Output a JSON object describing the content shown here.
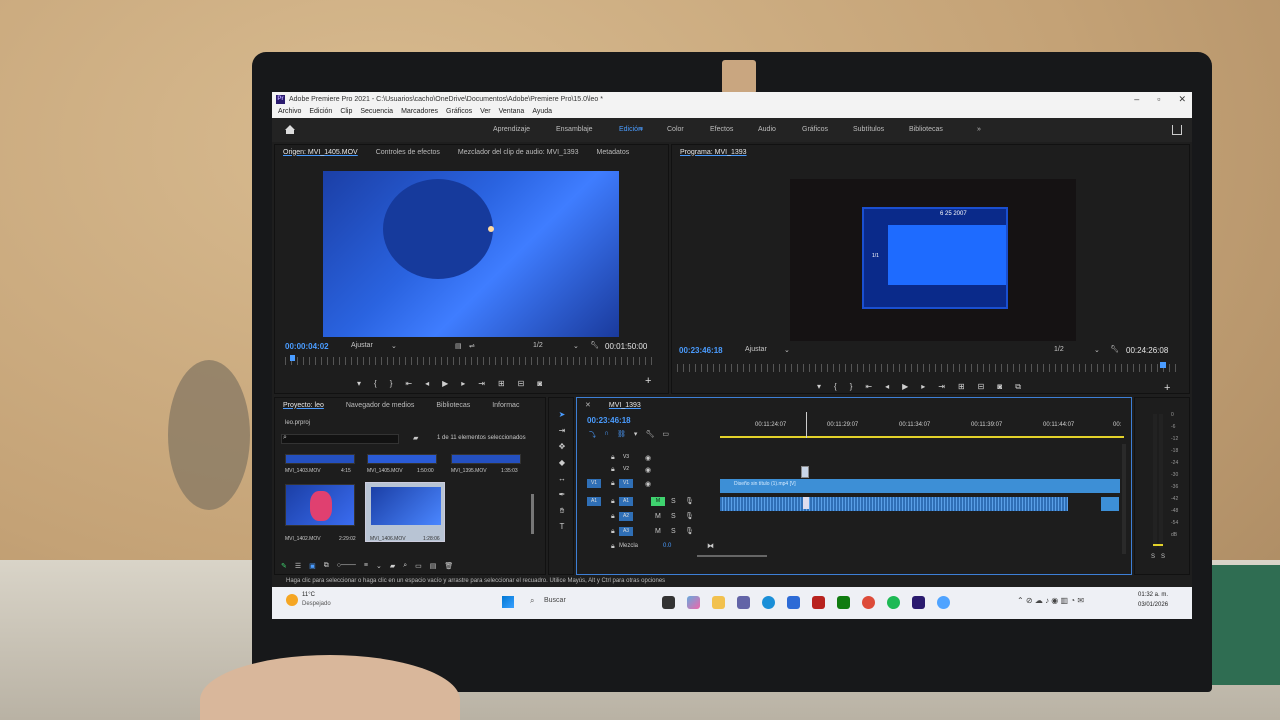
{
  "window": {
    "title": "Adobe Premiere Pro 2021 - C:\\Usuarios\\cacho\\OneDrive\\Documentos\\Adobe\\Premiere Pro\\15.0\\leo *"
  },
  "menu": [
    "Archivo",
    "Edición",
    "Clip",
    "Secuencia",
    "Marcadores",
    "Gráficos",
    "Ver",
    "Ventana",
    "Ayuda"
  ],
  "workspaces": [
    "Aprendizaje",
    "Ensamblaje",
    "Edición",
    "Color",
    "Efectos",
    "Audio",
    "Gráficos",
    "Subtítulos",
    "Bibliotecas"
  ],
  "active_workspace": "Edición",
  "source_panel": {
    "tabs": [
      "Origen: MVI_1405.MOV",
      "Controles de efectos",
      "Mezclador del clip de audio: MVI_1393",
      "Metadatos"
    ],
    "timecode": "00:00:04:02",
    "fit": "Ajustar",
    "resolution": "1/2",
    "duration": "00:01:50:00"
  },
  "program_panel": {
    "tab": "Programa: MVI_1393",
    "timecode": "00:23:46:18",
    "fit": "Ajustar",
    "resolution": "1/2",
    "duration": "00:24:26:08",
    "screen_date": "6 25 2007",
    "screen_counter": "1/1"
  },
  "project_panel": {
    "tabs": [
      "Proyecto: leo",
      "Navegador de medios",
      "Bibliotecas",
      "Informac"
    ],
    "file": "leo.prproj",
    "selection": "1 de 11 elementos seleccionados",
    "items": [
      {
        "name": "MVI_1403.MOV",
        "duration": "4:15"
      },
      {
        "name": "MVI_1405.MOV",
        "duration": "1:50:00"
      },
      {
        "name": "MVI_1395.MOV",
        "duration": "1:35:03"
      },
      {
        "name": "MVI_1402.MOV",
        "duration": "2:29:02"
      },
      {
        "name": "MVI_1406.MOV",
        "duration": "1:28:06"
      }
    ]
  },
  "timeline": {
    "tab": "MVI_1393",
    "timecode": "00:23:46:18",
    "ruler": [
      "00:11:24:07",
      "00:11:29:07",
      "00:11:34:07",
      "00:11:39:07",
      "00:11:44:07",
      "00:"
    ],
    "tracks": [
      "V3",
      "V2",
      "V1",
      "A1",
      "A2",
      "A3"
    ],
    "clip_label": "Diseño sin título (1).mp4 [V]",
    "mix_label": "Mezcla",
    "mix_value": "0.0",
    "meter_scale": [
      "0",
      "-6",
      "-12",
      "-18",
      "-24",
      "-30",
      "-36",
      "-42",
      "-48",
      "-54",
      "dB"
    ],
    "meter_solo": [
      "S",
      "S"
    ]
  },
  "statusbar": {
    "text": "Haga clic para seleccionar o haga clic en un espacio vacío y arrastre para seleccionar el recuadro. Utilice Mayús, Alt y Ctrl para otras opciones"
  },
  "taskbar": {
    "weather_temp": "11°C",
    "weather_text": "Despejado",
    "search": "Buscar",
    "time": "01:32 a. m.",
    "date": "03/01/2026"
  }
}
